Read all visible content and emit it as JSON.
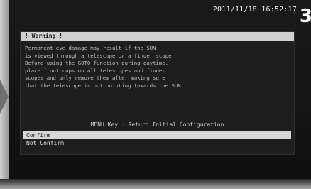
{
  "status": {
    "datetime": "2011/11/18 16:52:17",
    "corner_number": "3"
  },
  "dialog": {
    "title": "! Warning !",
    "message_lines": [
      "Permanent eye damage may result if the SUN",
      "is viewed through a telescope or a finder scope.",
      "Before using the GOTO function during daytime,",
      "place front caps on all telescopes and finder",
      "scopes and only remove them after making sure",
      "that the telescope is not pointing towards the SUN."
    ],
    "menu_key_text": "MENU Key : Return Initial Configuration",
    "options": [
      {
        "label": "Confirm",
        "selected": true
      },
      {
        "label": "Not Confirm",
        "selected": false
      }
    ]
  },
  "colors": {
    "screen_background": "#101010",
    "highlight": "#d6d6d6",
    "text": "#bfbfbf"
  }
}
